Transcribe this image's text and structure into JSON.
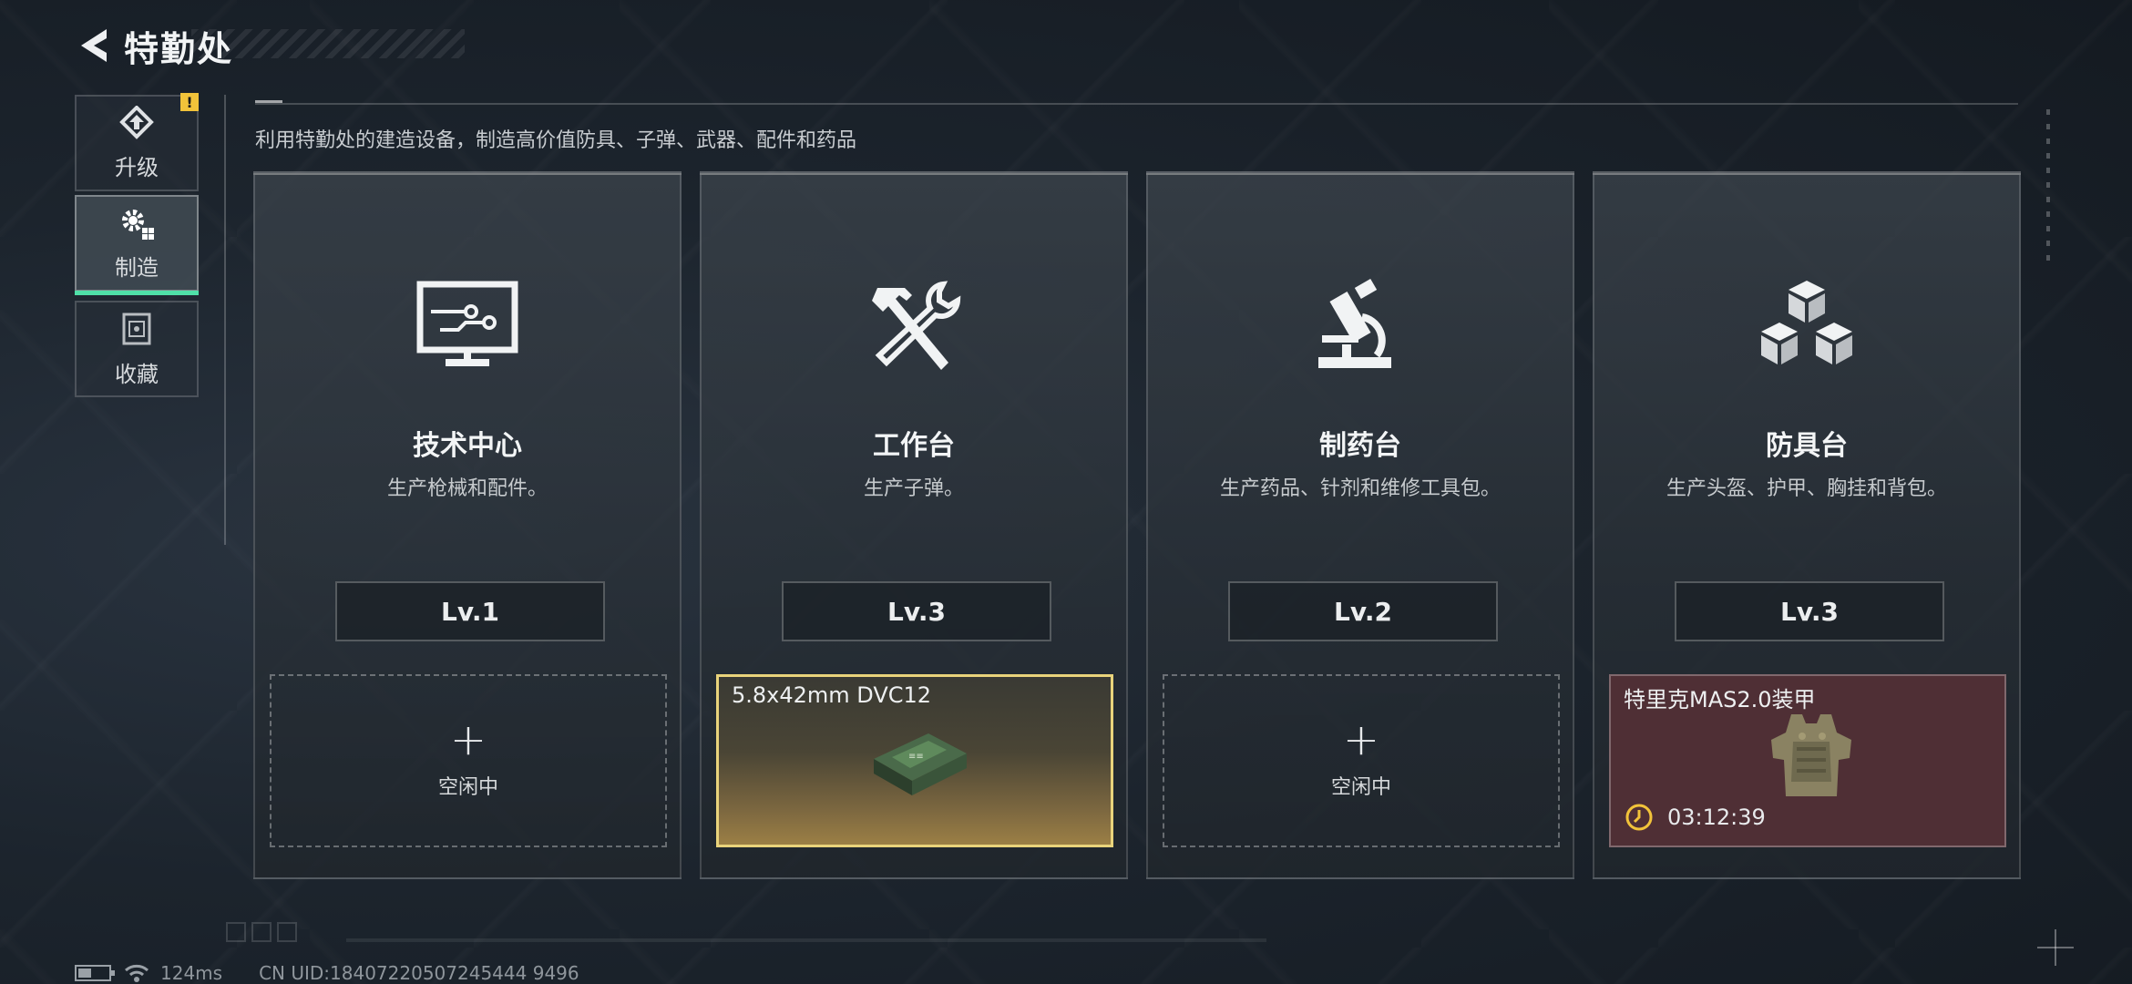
{
  "header": {
    "title": "特勤处"
  },
  "nav": {
    "items": [
      {
        "label": "升级",
        "icon": "upgrade-icon",
        "badge": "!",
        "active": false
      },
      {
        "label": "制造",
        "icon": "gear-icon",
        "active": true
      },
      {
        "label": "收藏",
        "icon": "collection-icon",
        "active": false
      }
    ]
  },
  "subtitle": "利用特勤处的建造设备，制造高价值防具、子弹、武器、配件和药品",
  "cards": [
    {
      "name": "技术中心",
      "desc": "生产枪械和配件。",
      "level": "Lv.1",
      "icon": "monitor-circuit-icon",
      "slot": {
        "state": "idle",
        "plus": "+",
        "label": "空闲中"
      }
    },
    {
      "name": "工作台",
      "desc": "生产子弹。",
      "level": "Lv.3",
      "icon": "hammer-wrench-icon",
      "slot": {
        "state": "producing",
        "item": "5.8x42mm DVC12",
        "item_icon": "ammo-box-icon"
      }
    },
    {
      "name": "制药台",
      "desc": "生产药品、针剂和维修工具包。",
      "level": "Lv.2",
      "icon": "microscope-icon",
      "slot": {
        "state": "idle",
        "plus": "+",
        "label": "空闲中"
      }
    },
    {
      "name": "防具台",
      "desc": "生产头盔、护甲、胸挂和背包。",
      "level": "Lv.3",
      "icon": "cubes-icon",
      "slot": {
        "state": "producing",
        "item": "特里克MAS2.0装甲",
        "item_icon": "body-armor-icon",
        "timer": "03:12:39"
      }
    }
  ],
  "footer": {
    "ping": "124ms",
    "uid": "CN UID:18407220507245444 9496"
  },
  "colors": {
    "accent": "#4fe0a8",
    "ammo_border": "#e9d37b",
    "armor_bg": "#4f2f35",
    "warning": "#f2c33a"
  }
}
